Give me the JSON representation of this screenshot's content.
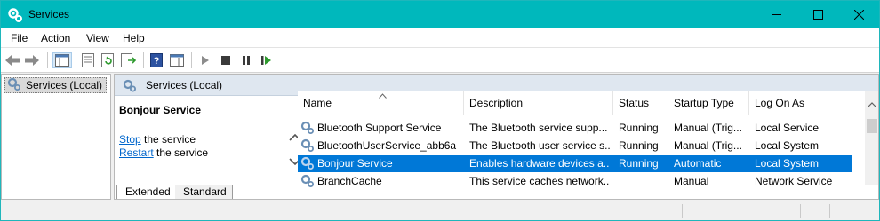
{
  "window": {
    "title": "Services",
    "controls": [
      "minimize",
      "maximize",
      "close"
    ]
  },
  "menu": [
    "File",
    "Action",
    "View",
    "Help"
  ],
  "toolbar": {
    "icons": [
      "back-arrow-icon",
      "forward-arrow-icon",
      "console-tree-icon",
      "properties-icon",
      "refresh-icon",
      "export-list-icon",
      "help-icon",
      "show-hide-action-pane-icon",
      "start-service-icon",
      "stop-service-icon",
      "pause-service-icon",
      "restart-service-icon"
    ]
  },
  "tree": {
    "selected": "Services (Local)"
  },
  "main": {
    "header": "Services (Local)",
    "detail": {
      "service_name": "Bonjour Service",
      "stop_link": "Stop",
      "stop_rest": " the service",
      "restart_link": "Restart",
      "restart_rest": " the service"
    },
    "columns": [
      "Name",
      "Description",
      "Status",
      "Startup Type",
      "Log On As"
    ],
    "rows": [
      {
        "name": "Bluetooth Support Service",
        "description": "The Bluetooth service supp...",
        "status": "Running",
        "startup": "Manual (Trig...",
        "logon": "Local Service"
      },
      {
        "name": "BluetoothUserService_abb6a",
        "description": "The Bluetooth user service s...",
        "status": "Running",
        "startup": "Manual (Trig...",
        "logon": "Local System"
      },
      {
        "name": "Bonjour Service",
        "description": "Enables hardware devices a...",
        "status": "Running",
        "startup": "Automatic",
        "logon": "Local System",
        "selected": true
      },
      {
        "name": "BranchCache",
        "description": "This service caches network...",
        "status": "",
        "startup": "Manual",
        "logon": "Network Service"
      }
    ],
    "tabs": [
      "Extended",
      "Standard"
    ],
    "active_tab": "Extended"
  },
  "colors": {
    "titlebar": "#00b8bc",
    "selection": "#0078d7",
    "link": "#0066cc"
  }
}
